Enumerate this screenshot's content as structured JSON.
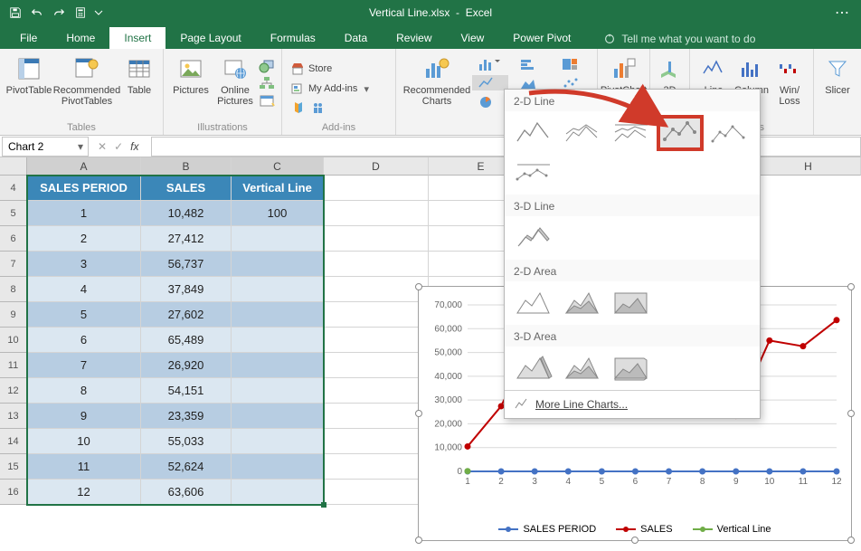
{
  "app": {
    "doc_title": "Vertical Line.xlsx",
    "app_name": "Excel"
  },
  "tabs": {
    "file": "File",
    "home": "Home",
    "insert": "Insert",
    "page_layout": "Page Layout",
    "formulas": "Formulas",
    "data": "Data",
    "review": "Review",
    "view": "View",
    "powerpivot": "Power Pivot",
    "tell_me": "Tell me what you want to do"
  },
  "ribbon": {
    "pivottable": "PivotTable",
    "recommended_pivottables": "Recommended\nPivotTables",
    "table": "Table",
    "tables": "Tables",
    "pictures": "Pictures",
    "online_pictures": "Online\nPictures",
    "illustrations": "Illustrations",
    "store": "Store",
    "my_addins": "My Add-ins",
    "addins": "Add-ins",
    "recommended_charts": "Recommended\nCharts",
    "pivotchart": "PivotChart",
    "threedmap": "3D\nMap",
    "line": "Line",
    "column": "Column",
    "winloss": "Win/\nLoss",
    "sparklines": "klines",
    "slicer": "Slicer"
  },
  "namebox": "Chart 2",
  "headers": {
    "A": "SALES PERIOD",
    "B": "SALES",
    "C": "Vertical Line"
  },
  "rows": [
    {
      "period": "1",
      "sales": "10,482",
      "vl": "100"
    },
    {
      "period": "2",
      "sales": "27,412",
      "vl": ""
    },
    {
      "period": "3",
      "sales": "56,737",
      "vl": ""
    },
    {
      "period": "4",
      "sales": "37,849",
      "vl": ""
    },
    {
      "period": "5",
      "sales": "27,602",
      "vl": ""
    },
    {
      "period": "6",
      "sales": "65,489",
      "vl": ""
    },
    {
      "period": "7",
      "sales": "26,920",
      "vl": ""
    },
    {
      "period": "8",
      "sales": "54,151",
      "vl": ""
    },
    {
      "period": "9",
      "sales": "23,359",
      "vl": ""
    },
    {
      "period": "10",
      "sales": "55,033",
      "vl": ""
    },
    {
      "period": "11",
      "sales": "52,624",
      "vl": ""
    },
    {
      "period": "12",
      "sales": "63,606",
      "vl": ""
    }
  ],
  "chart_menu": {
    "sec_2d_line": "2-D Line",
    "sec_3d_line": "3-D Line",
    "sec_2d_area": "2-D Area",
    "sec_3d_area": "3-D Area",
    "more": "More Line Charts..."
  },
  "chart_data": {
    "type": "line",
    "categories": [
      1,
      2,
      3,
      4,
      5,
      6,
      7,
      8,
      9,
      10,
      11,
      12
    ],
    "series": [
      {
        "name": "SALES PERIOD",
        "values": [
          1,
          2,
          3,
          4,
          5,
          6,
          7,
          8,
          9,
          10,
          11,
          12
        ],
        "color": "#4472c4"
      },
      {
        "name": "SALES",
        "values": [
          10482,
          27412,
          56737,
          37849,
          27602,
          65489,
          26920,
          54151,
          23359,
          55033,
          52624,
          63606
        ],
        "color": "#c00000"
      },
      {
        "name": "Vertical Line",
        "values": [
          100,
          null,
          null,
          null,
          null,
          null,
          null,
          null,
          null,
          null,
          null,
          null
        ],
        "color": "#70ad47"
      }
    ],
    "ylim": [
      0,
      70000
    ],
    "yticks": [
      0,
      10000,
      20000,
      30000,
      40000,
      50000,
      60000,
      70000
    ],
    "ytick_labels": [
      "0",
      "10,000",
      "20,000",
      "30,000",
      "40,000",
      "50,000",
      "60,000",
      "70,000"
    ],
    "legend": [
      "SALES PERIOD",
      "SALES",
      "Vertical Line"
    ]
  }
}
